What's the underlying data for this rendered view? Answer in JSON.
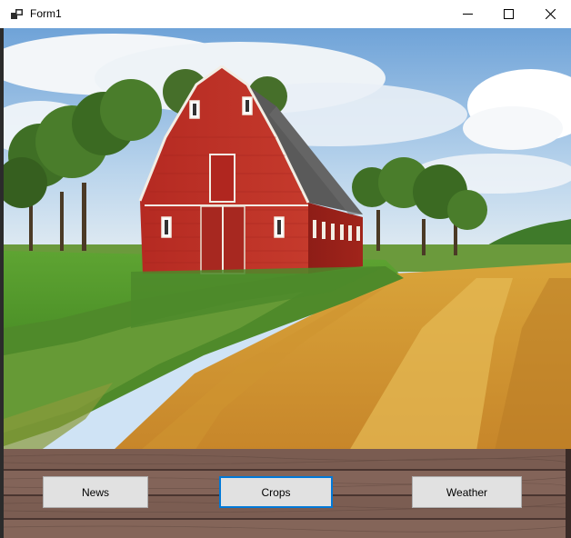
{
  "window": {
    "title": "Form1",
    "icon": "windows-forms-icon",
    "controls": {
      "minimize": "minimize-icon",
      "maximize": "maximize-icon",
      "close": "close-icon"
    }
  },
  "scene": {
    "description_icon": "farm-barn-picture"
  },
  "buttons": {
    "news": "News",
    "crops": "Crops",
    "weather": "Weather",
    "focused": "crops"
  },
  "colors": {
    "focus_border": "#0078d7",
    "button_face": "#e1e1e1",
    "barn_red": "#b52a22"
  }
}
